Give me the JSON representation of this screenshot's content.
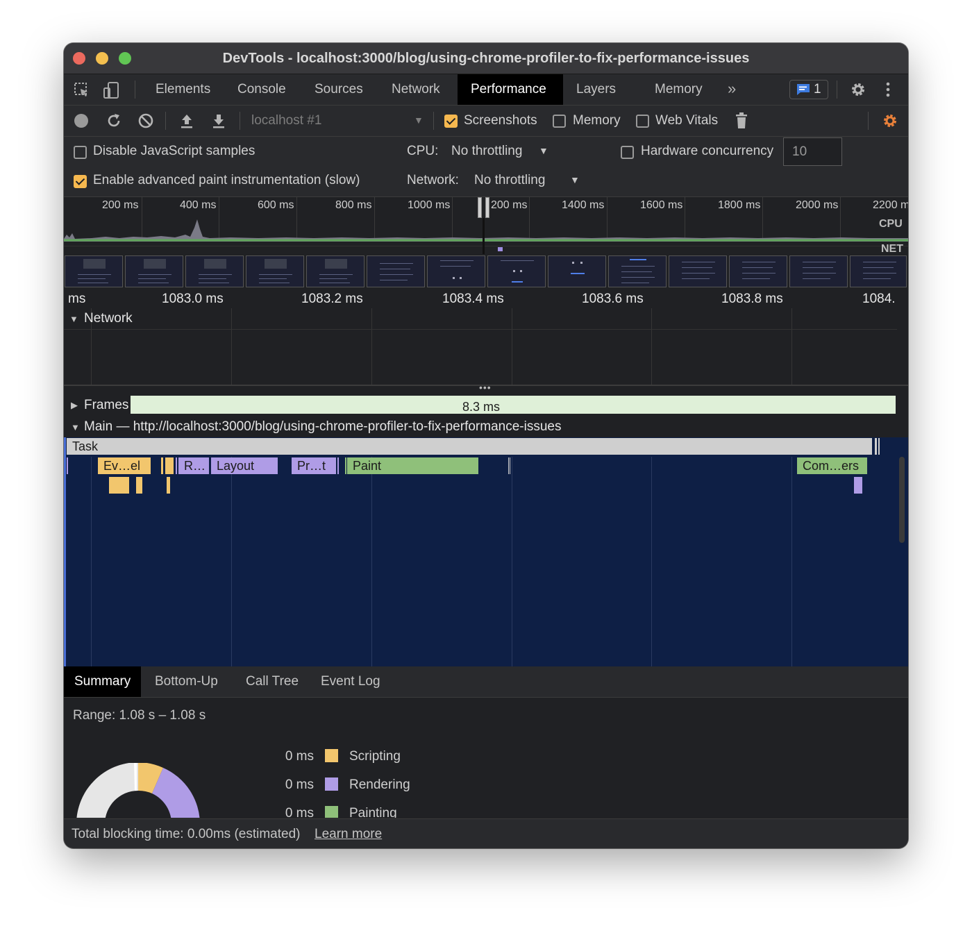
{
  "window": {
    "title": "DevTools - localhost:3000/blog/using-chrome-profiler-to-fix-performance-issues"
  },
  "tabs": [
    {
      "label": "Elements"
    },
    {
      "label": "Console"
    },
    {
      "label": "Sources"
    },
    {
      "label": "Network"
    },
    {
      "label": "Performance",
      "active": true
    },
    {
      "label": "Layers"
    },
    {
      "label": "Memory"
    }
  ],
  "issues_badge": "1",
  "toolbar": {
    "target": "localhost #1",
    "screenshots_label": "Screenshots",
    "screenshots_checked": true,
    "memory_label": "Memory",
    "memory_checked": false,
    "web_vitals_label": "Web Vitals",
    "web_vitals_checked": false
  },
  "settings": {
    "disable_js_label": "Disable JavaScript samples",
    "disable_js_checked": false,
    "advanced_paint_label": "Enable advanced paint instrumentation (slow)",
    "advanced_paint_checked": true,
    "cpu_label": "CPU:",
    "cpu_value": "No throttling",
    "network_label": "Network:",
    "network_value": "No throttling",
    "hw_concurrency_label": "Hardware concurrency",
    "hw_concurrency_checked": false,
    "hw_concurrency_value": "10"
  },
  "overview": {
    "ticks": [
      "200 ms",
      "400 ms",
      "600 ms",
      "800 ms",
      "1000 ms",
      "200 ms",
      "1400 ms",
      "1600 ms",
      "1800 ms",
      "2000 ms",
      "2200 m"
    ],
    "cpu_label": "CPU",
    "net_label": "NET"
  },
  "ruler": {
    "labels": [
      "ms",
      "1083.0 ms",
      "1083.2 ms",
      "1083.4 ms",
      "1083.6 ms",
      "1083.8 ms",
      "1084."
    ]
  },
  "network_track": {
    "label": "Network"
  },
  "frames": {
    "label": "Frames",
    "duration": "8.3 ms"
  },
  "main_track": {
    "label": "Main — http://localhost:3000/blog/using-chrome-profiler-to-fix-performance-issues",
    "task_label": "Task",
    "events": [
      {
        "label": "Ev…el",
        "category": "scripting"
      },
      {
        "label": "R…",
        "category": "rendering"
      },
      {
        "label": "Layout",
        "category": "rendering"
      },
      {
        "label": "Pr…t",
        "category": "rendering"
      },
      {
        "label": "Paint",
        "category": "painting"
      },
      {
        "label": "Com…ers",
        "category": "painting"
      }
    ]
  },
  "bottom_tabs": [
    {
      "label": "Summary",
      "active": true
    },
    {
      "label": "Bottom-Up"
    },
    {
      "label": "Call Tree"
    },
    {
      "label": "Event Log"
    }
  ],
  "summary": {
    "range": "Range: 1.08 s – 1.08 s",
    "legend": [
      {
        "value": "0 ms",
        "name": "Scripting",
        "color": "#f2c66d"
      },
      {
        "value": "0 ms",
        "name": "Rendering",
        "color": "#af9ce6"
      },
      {
        "value": "0 ms",
        "name": "Painting",
        "color": "#8fc07a"
      }
    ]
  },
  "status": {
    "text": "Total blocking time: 0.00ms (estimated)",
    "link": "Learn more"
  },
  "colors": {
    "scripting": "#f2c66d",
    "rendering": "#af9ce6",
    "painting": "#8fc07a",
    "task": "#cfcfcf",
    "frames": "#dff0d8",
    "flame_bg": "#0e1f45",
    "accent": "#f6b84f"
  }
}
